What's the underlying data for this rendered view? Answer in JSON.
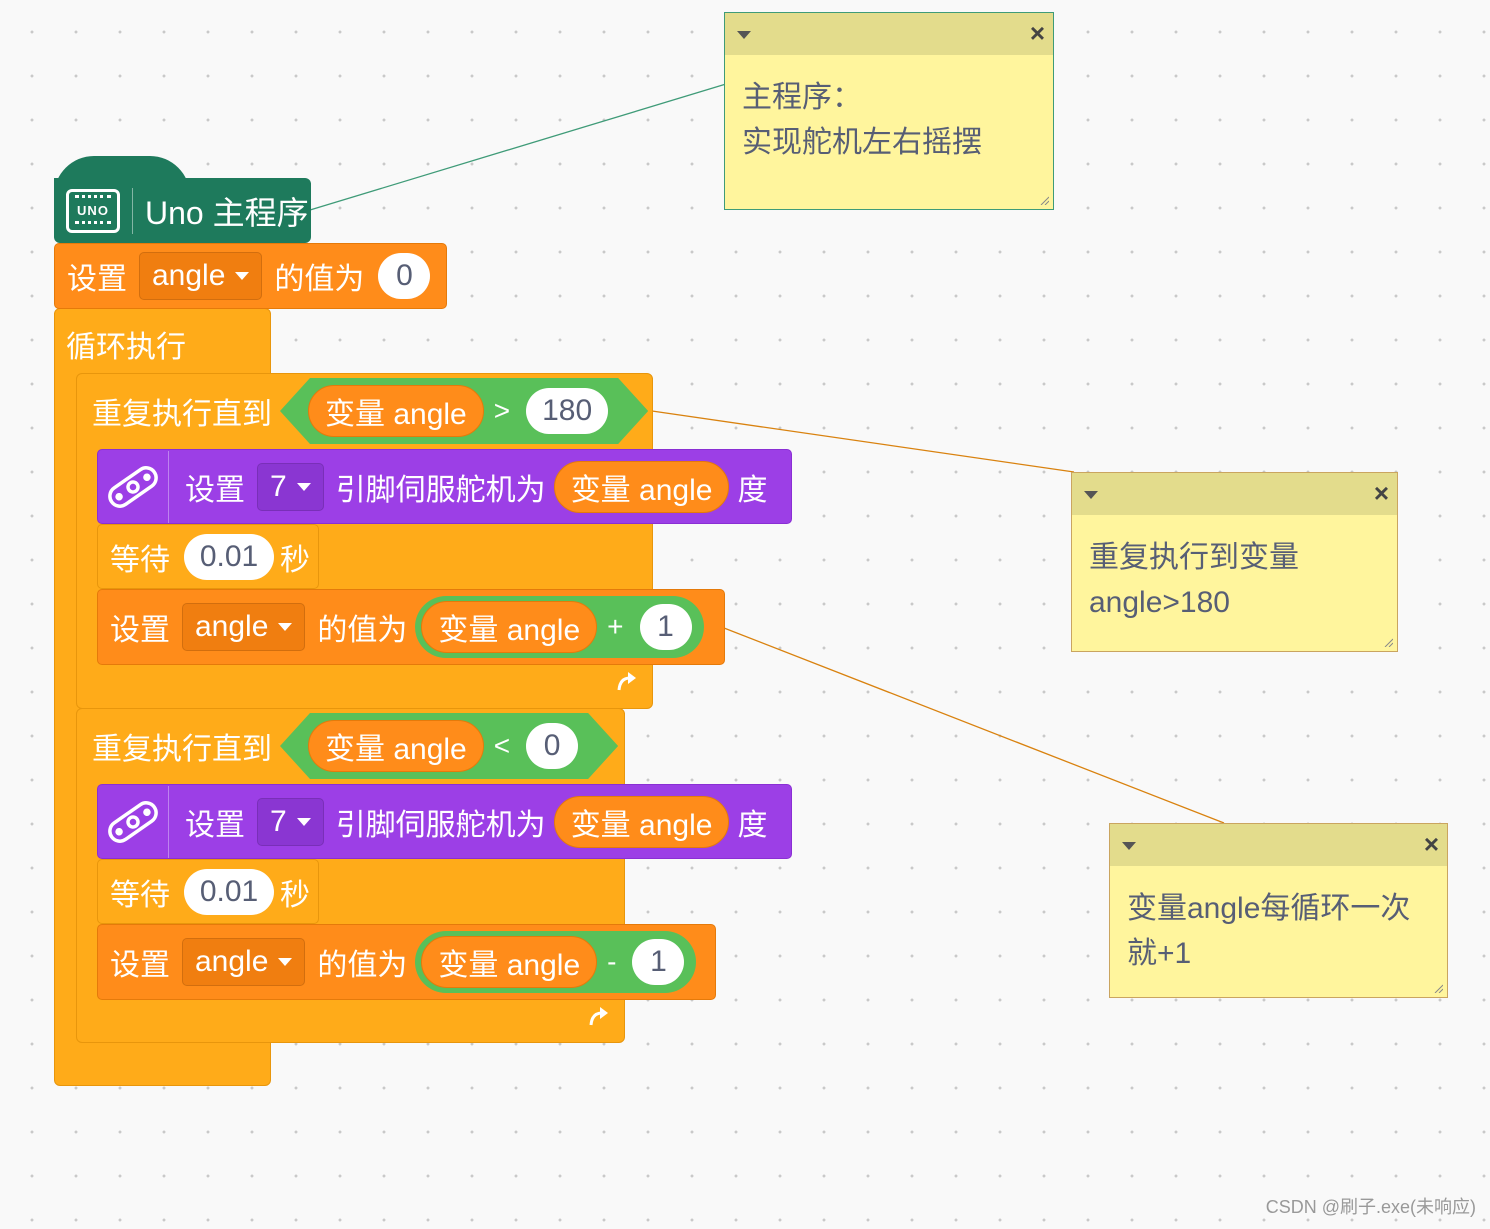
{
  "hat": {
    "label": "Uno 主程序",
    "icon": "uno-board-icon",
    "icon_text": "UNO"
  },
  "init_set": {
    "set_label": "设置",
    "var_name": "angle",
    "value_label": "的值为",
    "value": "0"
  },
  "forever": {
    "label": "循环执行"
  },
  "repeat1": {
    "label": "重复执行直到",
    "cond_var": "变量 angle",
    "operator": ">",
    "operand": "180",
    "servo": {
      "set_label": "设置",
      "pin": "7",
      "mid_label": "引脚伺服舵机为",
      "value_var": "变量 angle",
      "unit": "度",
      "icon": "servo-icon"
    },
    "wait": {
      "label": "等待",
      "value": "0.01",
      "unit": "秒"
    },
    "update": {
      "set_label": "设置",
      "var_name": "angle",
      "value_label": "的值为",
      "expr_var": "变量 angle",
      "operator": "+",
      "operand": "1"
    },
    "loop_icon": "loop-arrow-icon"
  },
  "repeat2": {
    "label": "重复执行直到",
    "cond_var": "变量 angle",
    "operator": "<",
    "operand": "0",
    "servo": {
      "set_label": "设置",
      "pin": "7",
      "mid_label": "引脚伺服舵机为",
      "value_var": "变量 angle",
      "unit": "度",
      "icon": "servo-icon"
    },
    "wait": {
      "label": "等待",
      "value": "0.01",
      "unit": "秒"
    },
    "update": {
      "set_label": "设置",
      "var_name": "angle",
      "value_label": "的值为",
      "expr_var": "变量 angle",
      "operator": "-",
      "operand": "1"
    },
    "loop_icon": "loop-arrow-icon"
  },
  "notes": [
    {
      "line1": "主程序：",
      "line2": "实现舵机左右摇摆"
    },
    {
      "line1": "重复执行到变量",
      "line2": "angle>180"
    },
    {
      "line1": "变量angle每循环一次",
      "line2": "就+1"
    }
  ],
  "colors": {
    "hat": "#1e7a5c",
    "variables": "#ff8c1a",
    "control": "#ffab19",
    "servo": "#9c3fe6",
    "operators": "#59c059",
    "note": "#fff59d",
    "note_header": "#e3dc8c",
    "connector_green": "#3f9b78",
    "connector_orange": "#d9820f"
  },
  "watermark": "CSDN @刷子.exe(未响应)"
}
